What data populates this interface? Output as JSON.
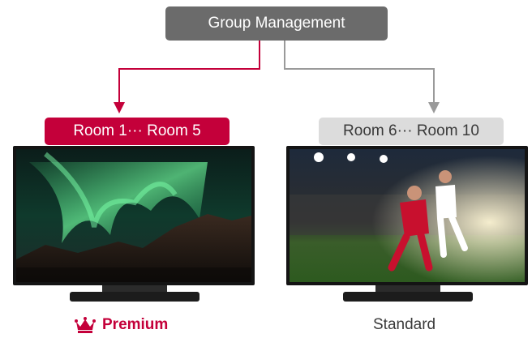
{
  "root": {
    "label": "Group Management"
  },
  "groups": [
    {
      "label": "Room 1··· Room 5",
      "tier": "Premium",
      "color": "#c4003a",
      "icon": "crown-icon"
    },
    {
      "label": "Room 6··· Room 10",
      "tier": "Standard",
      "color": "#9a9a9a"
    }
  ],
  "colors": {
    "accent": "#c4003a",
    "neutral": "#6b6b6b",
    "light": "#dcdcdc"
  }
}
